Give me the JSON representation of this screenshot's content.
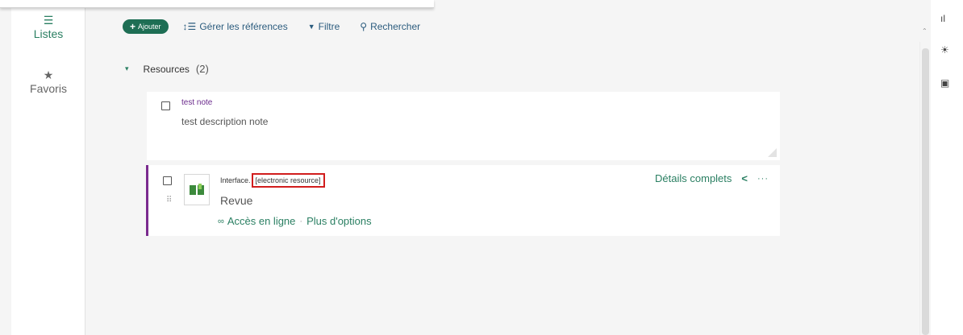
{
  "sidebar": {
    "items": [
      {
        "label": "Listes",
        "icon": "list-icon",
        "glyph": "☰",
        "active": true
      },
      {
        "label": "Favoris",
        "icon": "star-icon",
        "glyph": "★",
        "active": false
      }
    ]
  },
  "toolbar": {
    "add_label": "Ajouter",
    "add_glyph": "+",
    "manage_label": "Gérer les références",
    "manage_glyph": "↕☰",
    "filter_label": "Filtre",
    "filter_glyph": "▼",
    "search_label": "Rechercher",
    "search_glyph": "⚲"
  },
  "section": {
    "title": "Resources",
    "count": "(2)",
    "chevron_glyph": "▾"
  },
  "note": {
    "title": "test note",
    "description": "test description note"
  },
  "resource": {
    "title_prefix": "Interface.",
    "title_highlight": "[electronic resource]",
    "type": "Revue",
    "online_access": "Accès en ligne",
    "separator": "·",
    "more_options": "Plus d'options",
    "full_details": "Détails complets",
    "share_glyph": "<",
    "more_glyph": "···",
    "link_glyph": "∞",
    "drag_glyph": "⠿"
  },
  "right_panel": {
    "icons": [
      {
        "name": "chart-icon",
        "glyph": "ıl"
      },
      {
        "name": "lightbulb-icon",
        "glyph": "☀"
      },
      {
        "name": "calendar-icon",
        "glyph": "▣"
      }
    ],
    "scroll_up_glyph": "⌃"
  },
  "colors": {
    "accent": "#2a7f62",
    "add_button": "#1e6e54",
    "note_title": "#6b2a8c",
    "resource_border": "#7a2a8e",
    "highlight_box": "#d11d1d"
  }
}
